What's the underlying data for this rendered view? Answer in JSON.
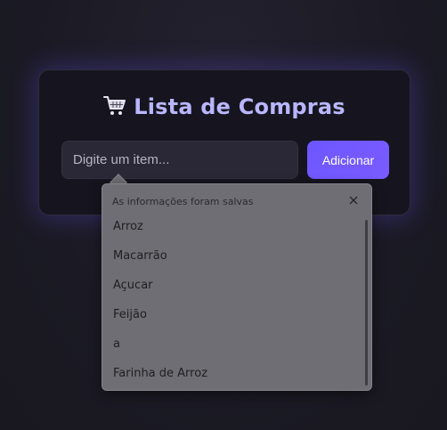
{
  "app": {
    "title": "Lista de Compras",
    "cart_icon": "shopping-cart-icon"
  },
  "form": {
    "input_placeholder": "Digite um item...",
    "input_value": "",
    "add_label": "Adicionar"
  },
  "autocomplete": {
    "header": "As informações foram salvas",
    "close_icon": "close-icon",
    "items": [
      "Arroz",
      "Macarrão",
      "Açucar",
      "Feijão",
      "a",
      "Farinha de Arroz"
    ]
  },
  "colors": {
    "accent": "#6d56ff",
    "title": "#b9b6ff",
    "background": "#1b1a24",
    "card": "#16151f",
    "popup": "#6f6e74"
  }
}
